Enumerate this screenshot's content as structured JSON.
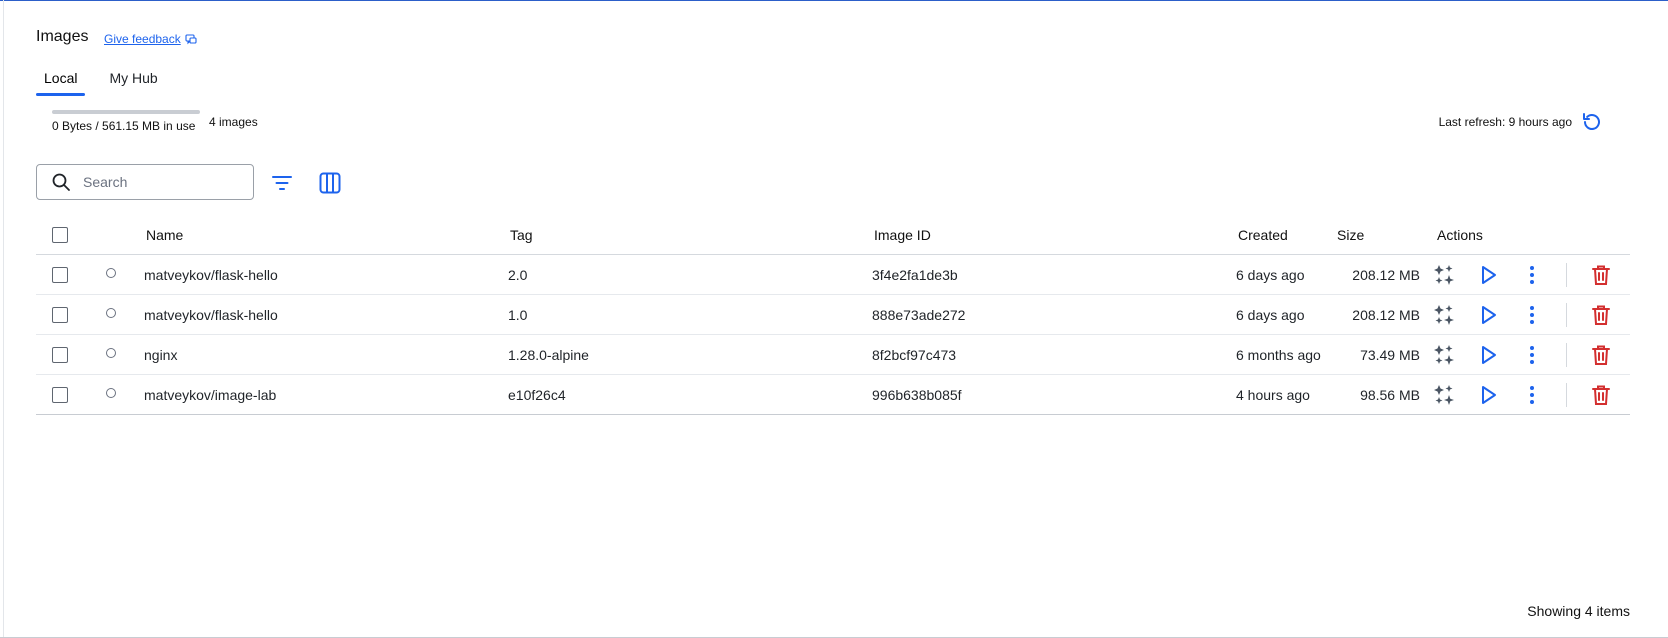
{
  "header": {
    "title": "Images",
    "feedback_label": "Give feedback"
  },
  "tabs": [
    {
      "label": "Local",
      "active": true
    },
    {
      "label": "My Hub",
      "active": false
    }
  ],
  "usage": {
    "text": "0 Bytes / 561.15 MB in use",
    "count": "4 images",
    "fraction_used": 0
  },
  "refresh": {
    "text": "Last refresh: 9 hours ago"
  },
  "search": {
    "placeholder": "Search",
    "value": ""
  },
  "table": {
    "columns": {
      "name": "Name",
      "tag": "Tag",
      "image_id": "Image ID",
      "created": "Created",
      "size": "Size",
      "actions": "Actions"
    },
    "rows": [
      {
        "name": "matveykov/flask-hello",
        "tag": "2.0",
        "image_id": "3f4e2fa1de3b",
        "created": "6 days ago",
        "size": "208.12 MB"
      },
      {
        "name": "matveykov/flask-hello",
        "tag": "1.0",
        "image_id": "888e73ade272",
        "created": "6 days ago",
        "size": "208.12 MB"
      },
      {
        "name": "nginx",
        "tag": "1.28.0-alpine",
        "image_id": "8f2bcf97c473",
        "created": "6 months ago",
        "size": "73.49 MB"
      },
      {
        "name": "matveykov/image-lab",
        "tag": "e10f26c4",
        "image_id": "996b638b085f",
        "created": "4 hours ago",
        "size": "98.56 MB"
      }
    ]
  },
  "footer": {
    "showing": "Showing 4 items"
  },
  "colors": {
    "accent": "#1d63ed",
    "danger": "#d32f2f",
    "action_gray": "#4a5563"
  }
}
